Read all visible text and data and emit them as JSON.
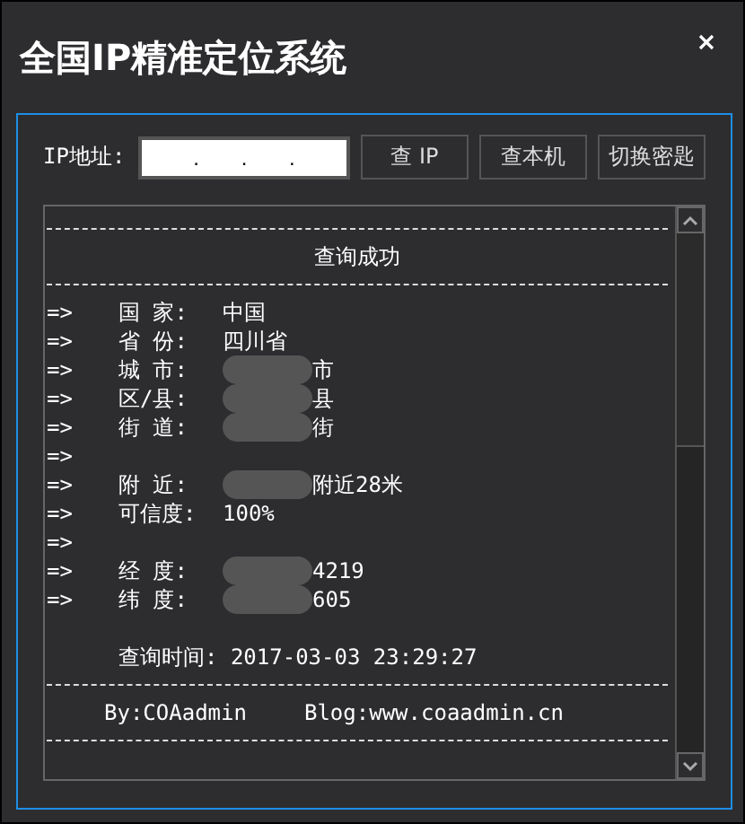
{
  "window": {
    "title": "全国IP精准定位系统"
  },
  "ip_label": "IP地址:",
  "ip_input": {
    "value": ". . ."
  },
  "buttons": [
    "查 IP",
    "查本机",
    "切换密匙"
  ],
  "output": {
    "heading": "查询成功",
    "rows": [
      {
        "marker": "=>",
        "label": "国 家:",
        "value": "中国"
      },
      {
        "marker": "=>",
        "label": "省 份:",
        "value": "四川省"
      },
      {
        "marker": "=>",
        "label": "城 市:",
        "value": "市",
        "redacted": true
      },
      {
        "marker": "=>",
        "label": "区/县:",
        "value": "县",
        "redacted": true
      },
      {
        "marker": "=>",
        "label": "街 道:",
        "value": "街",
        "redacted": true
      },
      {
        "marker": "=>"
      },
      {
        "marker": "=>",
        "label": "附 近:",
        "value": "附近28米",
        "redacted": true
      },
      {
        "marker": "=>",
        "label": "可信度:",
        "value": "100%"
      },
      {
        "marker": "=>"
      },
      {
        "marker": "=>",
        "label": "经 度:",
        "value": "4219",
        "redacted": true
      },
      {
        "marker": "=>",
        "label": "纬 度:",
        "value": "605",
        "redacted": true
      }
    ],
    "query_time": "查询时间: 2017-03-03 23:29:27",
    "footer": [
      "By:COAadmin",
      "Blog:www.coaadmin.cn"
    ]
  }
}
